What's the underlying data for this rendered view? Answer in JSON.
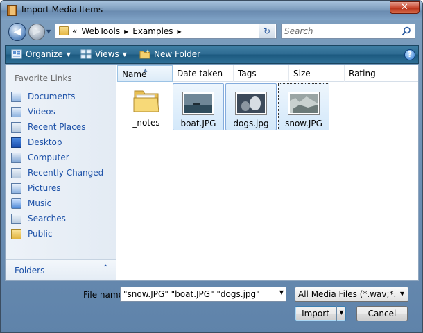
{
  "window": {
    "title": "Import Media Items",
    "close_glyph": "✕"
  },
  "nav": {
    "back_glyph": "◀",
    "forward_glyph": "▶",
    "address": {
      "prefix": "«",
      "crumbs": [
        "WebTools",
        "Examples"
      ],
      "sep": "▶"
    },
    "search_placeholder": "Search"
  },
  "toolbar": {
    "organize_label": "Organize",
    "views_label": "Views",
    "new_folder_label": "New Folder",
    "help_glyph": "?"
  },
  "sidebar": {
    "heading": "Favorite Links",
    "items": [
      {
        "label": "Documents",
        "icon": "documents-icon"
      },
      {
        "label": "Videos",
        "icon": "videos-icon"
      },
      {
        "label": "Recent Places",
        "icon": "recent-places-icon"
      },
      {
        "label": "Desktop",
        "icon": "desktop-icon"
      },
      {
        "label": "Computer",
        "icon": "computer-icon"
      },
      {
        "label": "Recently Changed",
        "icon": "recently-changed-icon"
      },
      {
        "label": "Pictures",
        "icon": "pictures-icon"
      },
      {
        "label": "Music",
        "icon": "music-icon"
      },
      {
        "label": "Searches",
        "icon": "searches-icon"
      },
      {
        "label": "Public",
        "icon": "folder-icon"
      }
    ],
    "folders_label": "Folders",
    "folders_chevron": "⌃"
  },
  "columns": [
    "Name",
    "Date taken",
    "Tags",
    "Size",
    "Rating"
  ],
  "files": [
    {
      "name": "_notes",
      "kind": "folder",
      "selected": false
    },
    {
      "name": "boat.JPG",
      "kind": "image",
      "selected": true
    },
    {
      "name": "dogs.jpg",
      "kind": "image",
      "selected": true
    },
    {
      "name": "snow.JPG",
      "kind": "image",
      "selected": true,
      "focused": true
    }
  ],
  "footer": {
    "file_name_label": "File name:",
    "file_name_value": "\"snow.JPG\" \"boat.JPG\" \"dogs.jpg\"",
    "file_type_value": "All Media Files (*.wav;*.aif;*.ai",
    "import_label": "Import",
    "cancel_label": "Cancel"
  },
  "colors": {
    "link_blue": "#1e52a8",
    "toolbar_teal": "#2e6b92",
    "selection_blue": "#d3e8fa"
  }
}
